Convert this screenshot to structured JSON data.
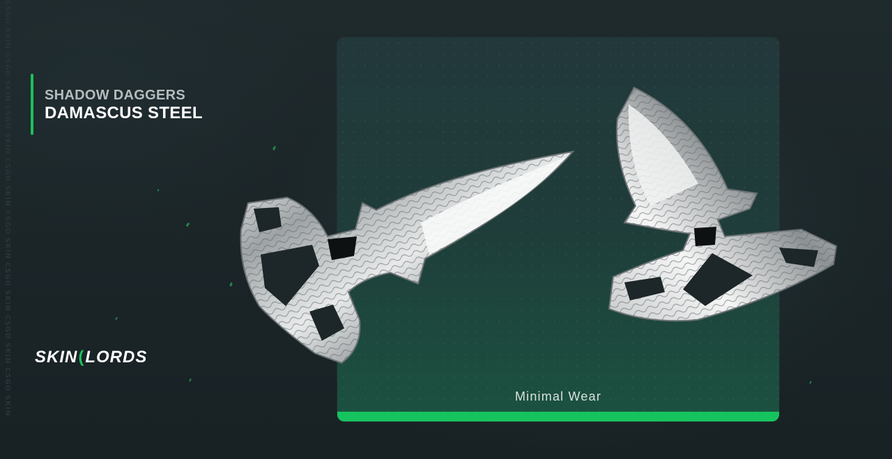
{
  "side_watermark": "CSGO SKIN CSGO SKIN CSGO SKIN CSGO SKIN CSGO SKIN CSGO SKIN CSGO SKIN CSGO SKIN",
  "item": {
    "weapon": "SHADOW DAGGERS",
    "skin": "DAMASCUS STEEL",
    "wear": "Minimal Wear"
  },
  "logo": {
    "left": "SKIN",
    "right": "LORDS"
  },
  "colors": {
    "accent": "#1fbf5b",
    "wear_bar": "#16c45f",
    "background": "#1b2427"
  },
  "icons": {
    "knife_left": "shadow-dagger-image",
    "knife_right": "shadow-dagger-image",
    "logo_mark": "crescent-icon"
  }
}
